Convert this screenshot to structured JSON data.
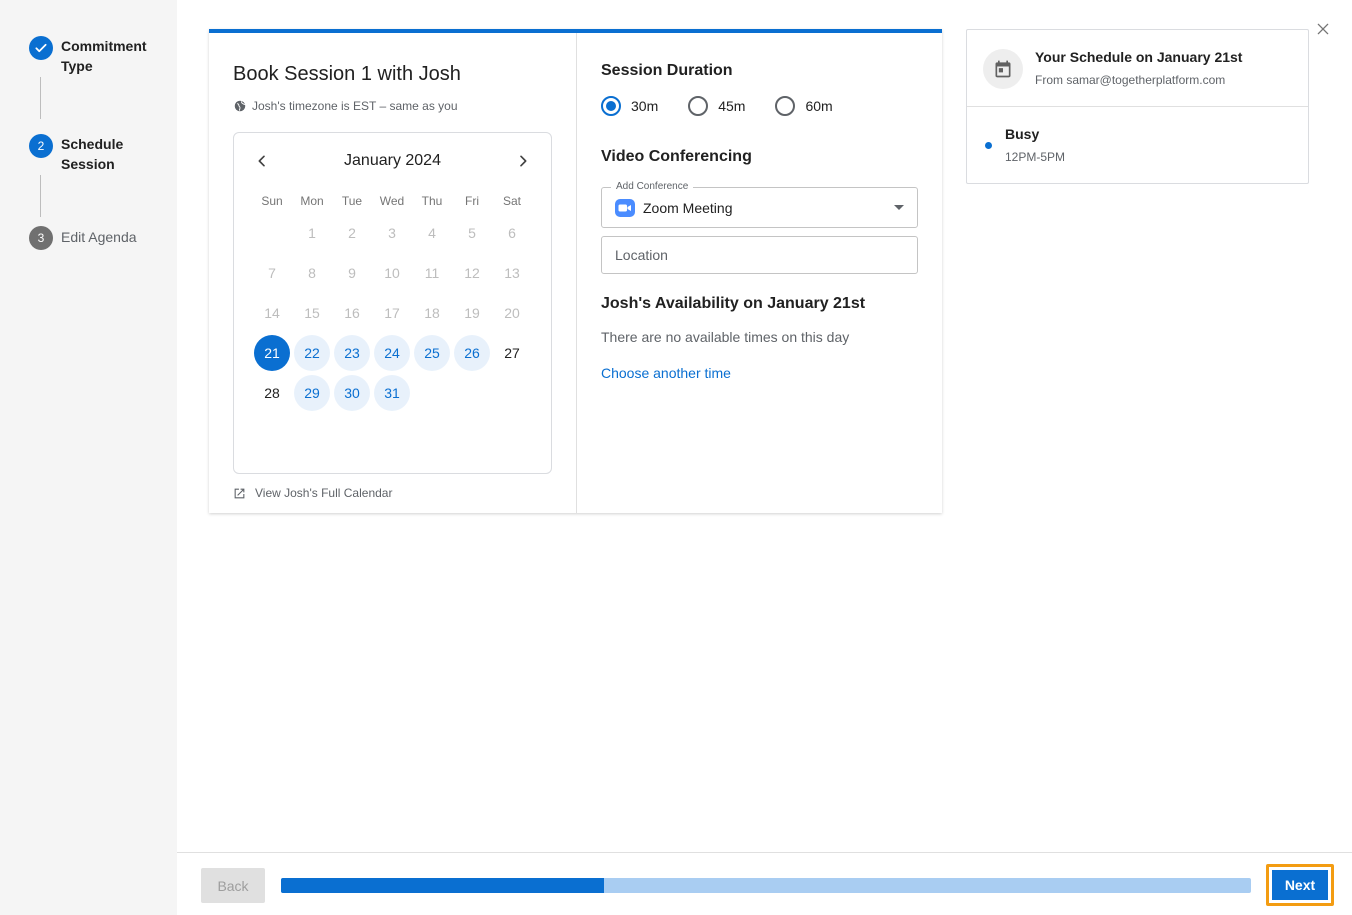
{
  "stepper": {
    "steps": [
      {
        "number": "",
        "label": "Commitment Type",
        "status": "done"
      },
      {
        "number": "2",
        "label": "Schedule Session",
        "status": "active"
      },
      {
        "number": "3",
        "label": "Edit Agenda",
        "status": "todo"
      }
    ]
  },
  "booking": {
    "title": "Book Session 1 with Josh",
    "timezone_note": "Josh's timezone is EST – same as you",
    "full_calendar_link": "View Josh's Full Calendar"
  },
  "calendar": {
    "month_label": "January 2024",
    "weekdays": [
      "Sun",
      "Mon",
      "Tue",
      "Wed",
      "Thu",
      "Fri",
      "Sat"
    ],
    "weeks": [
      [
        {
          "d": ""
        },
        {
          "d": "1",
          "s": "disabled"
        },
        {
          "d": "2",
          "s": "disabled"
        },
        {
          "d": "3",
          "s": "disabled"
        },
        {
          "d": "4",
          "s": "disabled"
        },
        {
          "d": "5",
          "s": "disabled"
        },
        {
          "d": "6",
          "s": "disabled"
        }
      ],
      [
        {
          "d": "7",
          "s": "disabled"
        },
        {
          "d": "8",
          "s": "disabled"
        },
        {
          "d": "9",
          "s": "disabled"
        },
        {
          "d": "10",
          "s": "disabled"
        },
        {
          "d": "11",
          "s": "disabled"
        },
        {
          "d": "12",
          "s": "disabled"
        },
        {
          "d": "13",
          "s": "disabled"
        }
      ],
      [
        {
          "d": "14",
          "s": "disabled"
        },
        {
          "d": "15",
          "s": "disabled"
        },
        {
          "d": "16",
          "s": "disabled"
        },
        {
          "d": "17",
          "s": "disabled"
        },
        {
          "d": "18",
          "s": "disabled"
        },
        {
          "d": "19",
          "s": "disabled"
        },
        {
          "d": "20",
          "s": "disabled"
        }
      ],
      [
        {
          "d": "21",
          "s": "selected"
        },
        {
          "d": "22",
          "s": "available"
        },
        {
          "d": "23",
          "s": "available"
        },
        {
          "d": "24",
          "s": "available"
        },
        {
          "d": "25",
          "s": "available"
        },
        {
          "d": "26",
          "s": "available"
        },
        {
          "d": "27",
          "s": "normal"
        }
      ],
      [
        {
          "d": "28",
          "s": "normal"
        },
        {
          "d": "29",
          "s": "available"
        },
        {
          "d": "30",
          "s": "available"
        },
        {
          "d": "31",
          "s": "available"
        },
        {
          "d": ""
        },
        {
          "d": ""
        },
        {
          "d": ""
        }
      ]
    ]
  },
  "session": {
    "duration_title": "Session Duration",
    "durations": [
      {
        "label": "30m",
        "checked": true
      },
      {
        "label": "45m",
        "checked": false
      },
      {
        "label": "60m",
        "checked": false
      }
    ],
    "video_title": "Video Conferencing",
    "conference_label": "Add Conference",
    "conference_value": "Zoom Meeting",
    "location_placeholder": "Location",
    "availability_title": "Josh's Availability on January 21st",
    "no_availability": "There are no available times on this day",
    "choose_another": "Choose another time"
  },
  "schedule": {
    "title": "Your Schedule on January 21st",
    "from": "From samar@togetherplatform.com",
    "busy_label": "Busy",
    "busy_time": "12PM-5PM"
  },
  "footer": {
    "back_label": "Back",
    "next_label": "Next",
    "progress_fraction": 0.333
  },
  "colors": {
    "accent": "#0a6fd1",
    "available_bg": "#e8f1fb",
    "progress_track": "#a9cdf2",
    "next_highlight": "#f39c12"
  }
}
